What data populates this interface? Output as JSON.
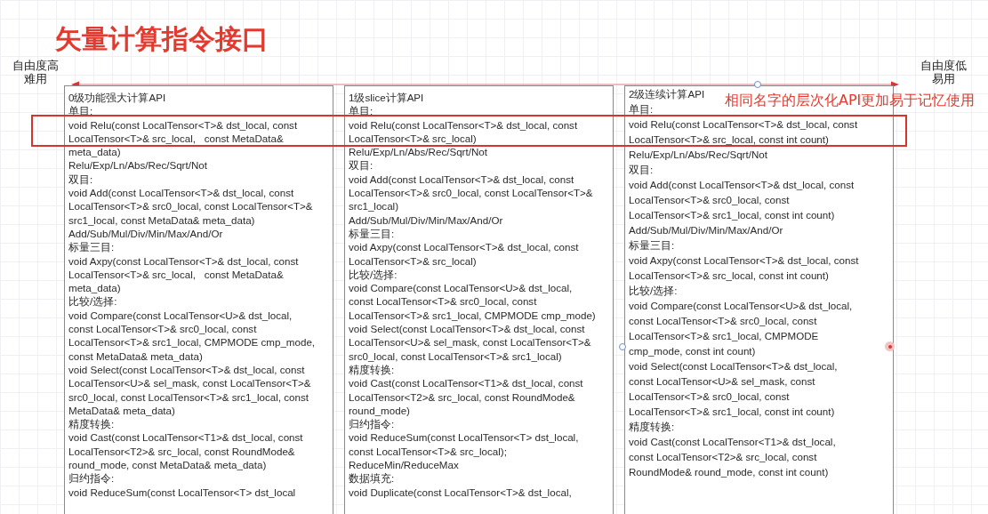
{
  "title": "矢量计算指令接口",
  "scale": {
    "left_label": [
      "自由度高",
      "难用"
    ],
    "right_label": [
      "自由度低",
      "易用"
    ]
  },
  "callout": "相同名字的层次化API更加易于记忆使用",
  "columns": [
    {
      "lines": [
        "0级功能强大计算API",
        "单目:",
        "void Relu(const LocalTensor<T>& dst_local, const",
        "LocalTensor<T>& src_local,   const MetaData&",
        "meta_data)",
        "Relu/Exp/Ln/Abs/Rec/Sqrt/Not",
        "双目:",
        "void Add(const LocalTensor<T>& dst_local, const",
        "LocalTensor<T>& src0_local, const LocalTensor<T>&",
        "src1_local, const MetaData& meta_data)",
        "Add/Sub/Mul/Div/Min/Max/And/Or",
        "标量三目:",
        "void Axpy(const LocalTensor<T>& dst_local, const",
        "LocalTensor<T>& src_local,   const MetaData&",
        "meta_data)",
        "比较/选择:",
        "void Compare(const LocalTensor<U>& dst_local,",
        "const LocalTensor<T>& src0_local, const",
        "LocalTensor<T>& src1_local, CMPMODE cmp_mode,",
        "const MetaData& meta_data)",
        "void Select(const LocalTensor<T>& dst_local, const",
        "LocalTensor<U>& sel_mask, const LocalTensor<T>&",
        "src0_local, const LocalTensor<T>& src1_local, const",
        "MetaData& meta_data)",
        "精度转换:",
        "void Cast(const LocalTensor<T1>& dst_local, const",
        "LocalTensor<T2>& src_local, const RoundMode&",
        "round_mode, const MetaData& meta_data)",
        "归约指令:",
        "void ReduceSum(const LocalTensor<T> dst_local"
      ]
    },
    {
      "lines": [
        "1级slice计算API",
        "单目:",
        "void Relu(const LocalTensor<T>& dst_local, const",
        "LocalTensor<T>& src_local)",
        "Relu/Exp/Ln/Abs/Rec/Sqrt/Not",
        "双目:",
        "void Add(const LocalTensor<T>& dst_local, const",
        "LocalTensor<T>& src0_local, const LocalTensor<T>&",
        "src1_local)",
        "Add/Sub/Mul/Div/Min/Max/And/Or",
        "标量三目:",
        "void Axpy(const LocalTensor<T>& dst_local, const",
        "LocalTensor<T>& src_local)",
        "比较/选择:",
        "void Compare(const LocalTensor<U>& dst_local,",
        "const LocalTensor<T>& src0_local, const",
        "LocalTensor<T>& src1_local, CMPMODE cmp_mode)",
        "void Select(const LocalTensor<T>& dst_local, const",
        "LocalTensor<U>& sel_mask, const LocalTensor<T>&",
        "src0_local, const LocalTensor<T>& src1_local)",
        "精度转换:",
        "void Cast(const LocalTensor<T1>& dst_local, const",
        "LocalTensor<T2>& src_local, const RoundMode&",
        "round_mode)",
        "归约指令:",
        "void ReduceSum(const LocalTensor<T> dst_local,",
        "const LocalTensor<T>& src_local);",
        "ReduceMin/ReduceMax",
        "数据填充:",
        "void Duplicate(const LocalTensor<T>& dst_local,"
      ]
    },
    {
      "lines": [
        "2级连续计算API",
        "单目:",
        "void Relu(const LocalTensor<T>& dst_local, const",
        "LocalTensor<T>& src_local, const int count)",
        "Relu/Exp/Ln/Abs/Rec/Sqrt/Not",
        "双目:",
        "void Add(const LocalTensor<T>& dst_local, const",
        "LocalTensor<T>& src0_local, const",
        "LocalTensor<T>& src1_local, const int count)",
        "Add/Sub/Mul/Div/Min/Max/And/Or",
        "标量三目:",
        "void Axpy(const LocalTensor<T>& dst_local, const",
        "LocalTensor<T>& src_local, const int count)",
        "比较/选择:",
        "void Compare(const LocalTensor<U>& dst_local,",
        "const LocalTensor<T>& src0_local, const",
        "LocalTensor<T>& src1_local, CMPMODE",
        "cmp_mode, const int count)",
        "void Select(const LocalTensor<T>& dst_local,",
        "const LocalTensor<U>& sel_mask, const",
        "LocalTensor<T>& src0_local, const",
        "LocalTensor<T>& src1_local, const int count)",
        "精度转换:",
        "void Cast(const LocalTensor<T1>& dst_local,",
        "const LocalTensor<T2>& src_local, const",
        "RoundMode& round_mode, const int count)"
      ]
    }
  ]
}
